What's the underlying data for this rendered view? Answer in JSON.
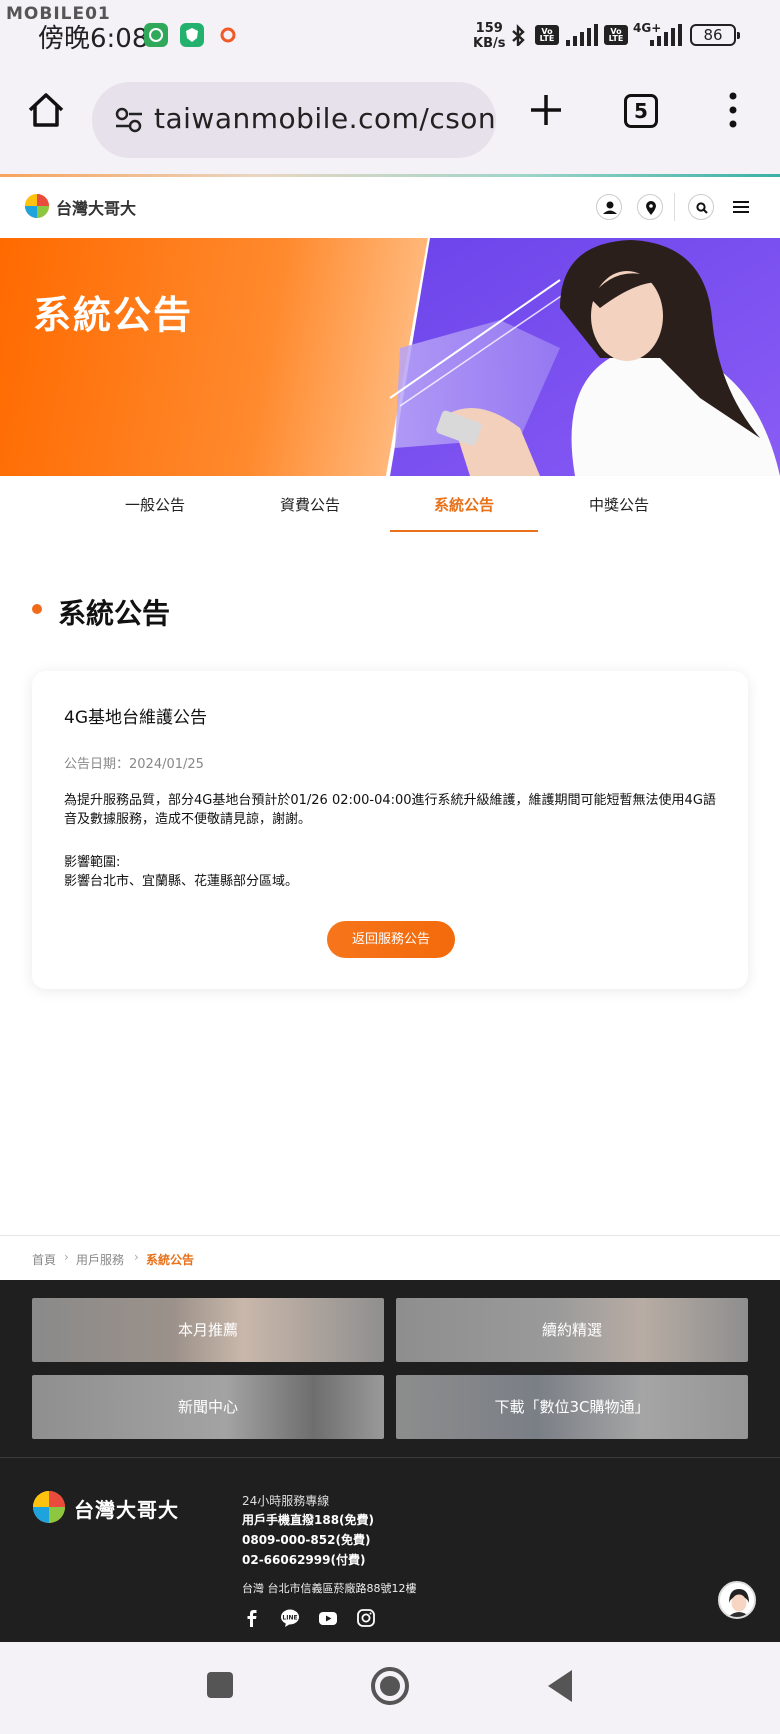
{
  "status_bar": {
    "watermark": "MOBILE01",
    "time": "傍晚6:08",
    "net_speed_value": "159",
    "net_speed_unit": "KB/s",
    "volte_label": "Vo LTE",
    "network_type": "4G+",
    "battery": "86"
  },
  "browser": {
    "url": "taiwanmobile.com/cson",
    "tab_count": "5"
  },
  "site_header": {
    "brand": "台灣大哥大"
  },
  "hero": {
    "title": "系統公告"
  },
  "tabs": [
    {
      "label": "一般公告",
      "active": false
    },
    {
      "label": "資費公告",
      "active": false
    },
    {
      "label": "系統公告",
      "active": true
    },
    {
      "label": "中獎公告",
      "active": false
    }
  ],
  "section": {
    "title": "系統公告"
  },
  "announcement": {
    "title": "4G基地台維護公告",
    "date": "公告日期：2024/01/25",
    "body": "為提升服務品質，部分4G基地台預計於01/26 02:00-04:00進行系統升級維護，維護期間可能短暫無法使用4G語音及數據服務，造成不便敬請見諒，謝謝。",
    "scope_label": "影響範圍:",
    "scope_text": "影響台北市、宜蘭縣、花蓮縣部分區域。",
    "back_button": "返回服務公告"
  },
  "breadcrumb": [
    "首頁",
    "用戶服務",
    "系統公告"
  ],
  "promos": [
    {
      "label": "本月推薦"
    },
    {
      "label": "續約精選"
    },
    {
      "label": "新聞中心"
    },
    {
      "label": "下載「數位3C購物通」"
    }
  ],
  "footer": {
    "brand": "台灣大哥大",
    "hotline_title": "24小時服務專線",
    "hotline_lines": [
      "用戶手機直撥188(免費)",
      "0809-000-852(免費)",
      "02-66062999(付費)"
    ],
    "address": "台灣 台北市信義區菸廠路88號12樓"
  },
  "colors": {
    "accent": "#e8711a",
    "hero_orange": "#ff6a00",
    "hero_purple": "#7b4cf0",
    "footer_bg": "#1f1f1f"
  }
}
